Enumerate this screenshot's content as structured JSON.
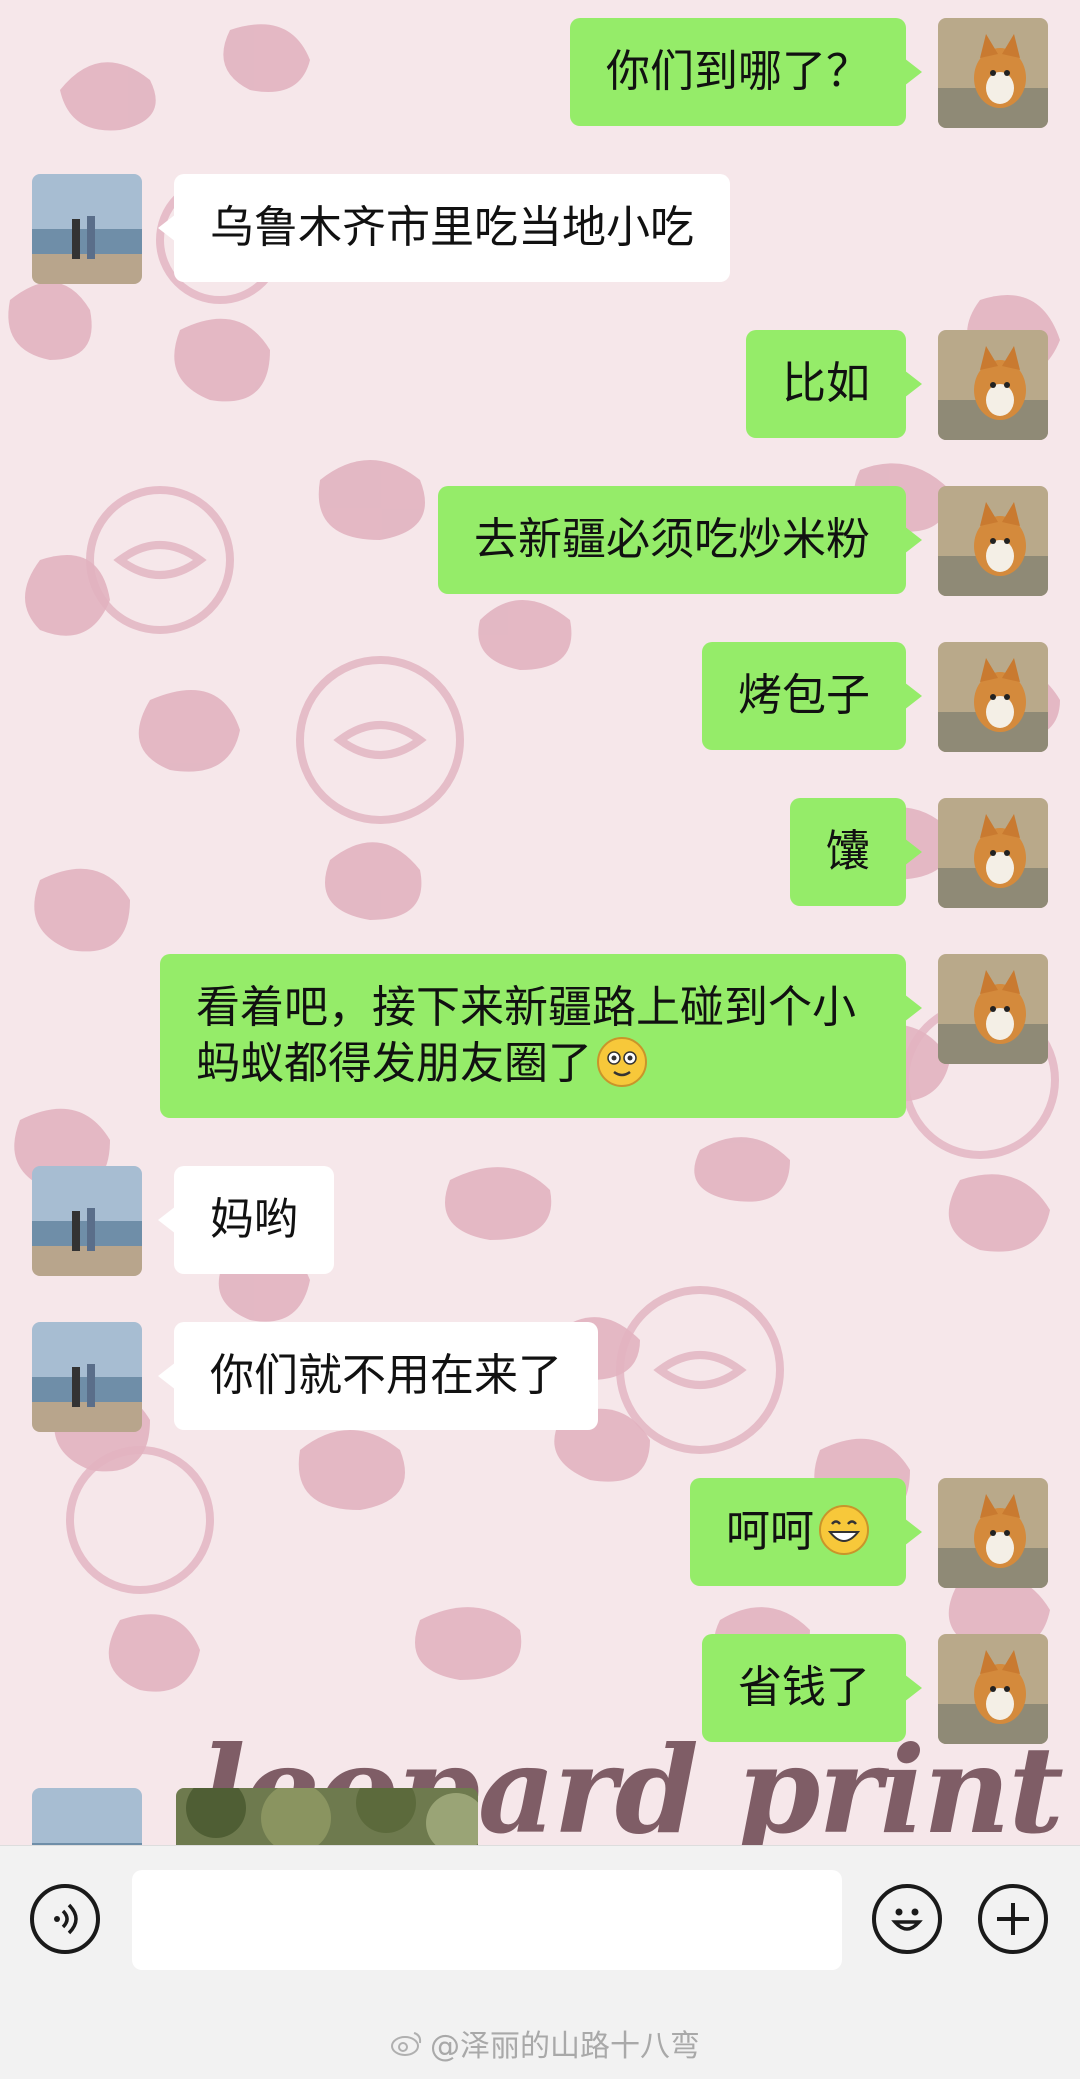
{
  "chat": {
    "messages": [
      {
        "side": "right",
        "text": "你们到哪了？"
      },
      {
        "side": "left",
        "text": "乌鲁木齐市里吃当地小吃"
      },
      {
        "side": "right",
        "text": "比如"
      },
      {
        "side": "right",
        "text": "去新疆必须吃炒米粉"
      },
      {
        "side": "right",
        "text": "烤包子"
      },
      {
        "side": "right",
        "text": "馕"
      },
      {
        "side": "right",
        "text": "看着吧，接下来新疆路上碰到个小蚂蚁都得发朋友圈了",
        "emoji": "flushed-smile"
      },
      {
        "side": "left",
        "text": "妈哟"
      },
      {
        "side": "left",
        "text": "你们就不用在来了"
      },
      {
        "side": "right",
        "text": "呵呵",
        "emoji": "grinning"
      },
      {
        "side": "right",
        "text": "省钱了"
      }
    ],
    "background_caption": "leopard print"
  },
  "input_bar": {
    "placeholder": "",
    "voice_icon": "voice-icon",
    "emoji_icon": "emoji-icon",
    "plus_icon": "plus-icon"
  },
  "watermark": {
    "text": "@泽丽的山路十八弯"
  },
  "colors": {
    "bubble_right": "#95ec69",
    "bubble_left": "#ffffff",
    "background": "#f6e7ea",
    "pattern": "#dcaab8"
  }
}
